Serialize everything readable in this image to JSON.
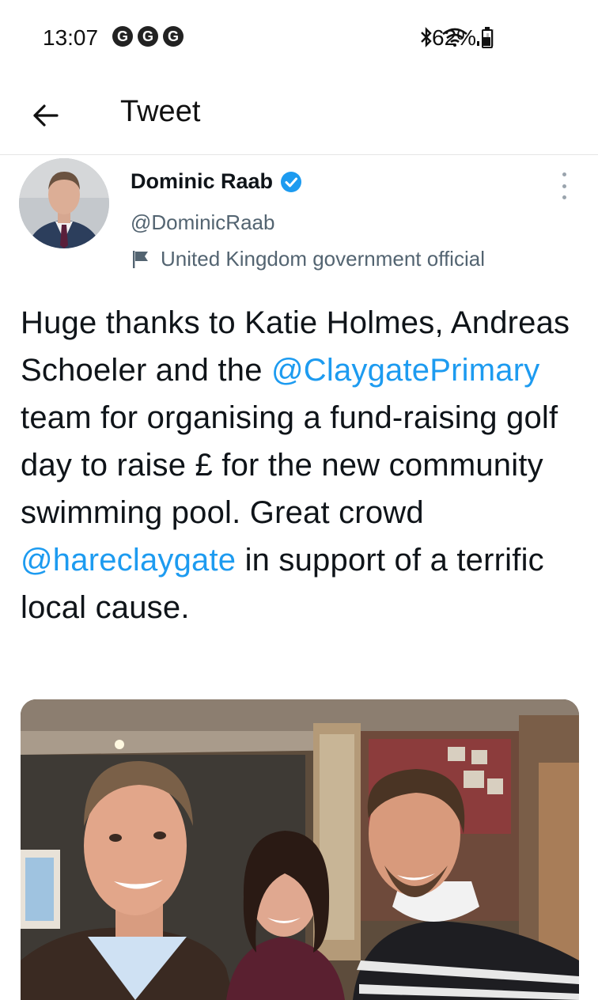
{
  "status_bar": {
    "time": "13:07",
    "notification_icons": [
      "G",
      "G",
      "G"
    ],
    "battery_percent": "62%",
    "battery_level": 0.62
  },
  "header": {
    "title": "Tweet"
  },
  "tweet": {
    "author_name": "Dominic Raab",
    "author_handle": "@DominicRaab",
    "affiliation": "United Kingdom government official",
    "text_parts": {
      "p1": "Huge thanks to Katie Holmes, Andreas Schoeler and the ",
      "mention1": "@ClaygatePrimary",
      "p2": " team for organising a fund-raising golf day to raise £ for the new community swimming pool. Great crowd ",
      "mention2": "@hareclaygate",
      "p3": " in support of a terrific local cause."
    }
  },
  "colors": {
    "accent": "#1d9bf0",
    "text": "#0f1419",
    "secondary_text": "#536471"
  },
  "icons": {
    "back": "arrow-left-icon",
    "verified": "verified-badge-icon",
    "affiliation": "flag-icon",
    "more": "more-vertical-icon"
  }
}
